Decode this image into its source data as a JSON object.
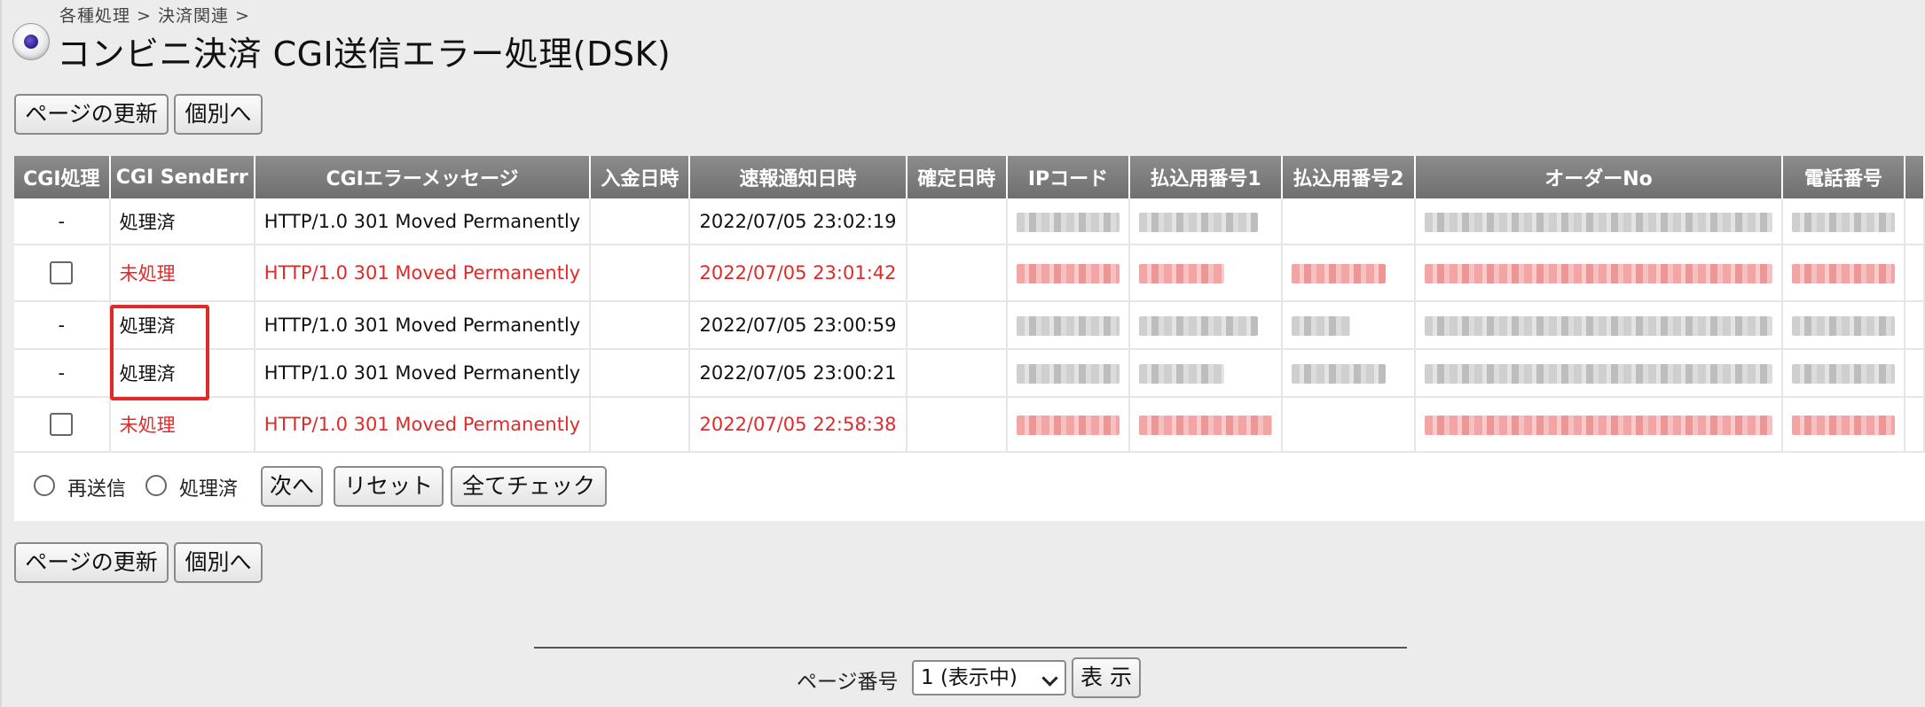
{
  "breadcrumb": "各種処理 > 決済関連 >",
  "title": "コンビニ決済 CGI送信エラー処理(DSK)",
  "buttons": {
    "refresh": "ページの更新",
    "individual": "個別へ",
    "next": "次へ",
    "reset": "リセット",
    "check_all": "全てチェック",
    "show": "表 示"
  },
  "radios": {
    "resend": "再送信",
    "processed": "処理済"
  },
  "table": {
    "headers": [
      "CGI処理",
      "CGI SendErr",
      "CGIエラーメッセージ",
      "入金日時",
      "速報通知日時",
      "確定日時",
      "IPコード",
      "払込用番号1",
      "払込用番号2",
      "オーダーNo",
      "電話番号"
    ],
    "rows": [
      {
        "action": "-",
        "status": "処理済",
        "message": "HTTP/1.0 301 Moved Permanently",
        "notify": "2022/07/05 23:02:19",
        "error": false
      },
      {
        "action": "",
        "status": "未処理",
        "message": "HTTP/1.0 301 Moved Permanently",
        "notify": "2022/07/05 23:01:42",
        "error": true
      },
      {
        "action": "-",
        "status": "処理済",
        "message": "HTTP/1.0 301 Moved Permanently",
        "notify": "2022/07/05 23:00:59",
        "error": false
      },
      {
        "action": "-",
        "status": "処理済",
        "message": "HTTP/1.0 301 Moved Permanently",
        "notify": "2022/07/05 23:00:21",
        "error": false
      },
      {
        "action": "",
        "status": "未処理",
        "message": "HTTP/1.0 301 Moved Permanently",
        "notify": "2022/07/05 22:58:38",
        "error": true
      }
    ]
  },
  "pager": {
    "label": "ページ番号",
    "selected": "1 (表示中)"
  },
  "colors": {
    "error_text": "#e02a2a",
    "header_bg": "#7d7d7d",
    "highlight": "#e02a2a"
  }
}
